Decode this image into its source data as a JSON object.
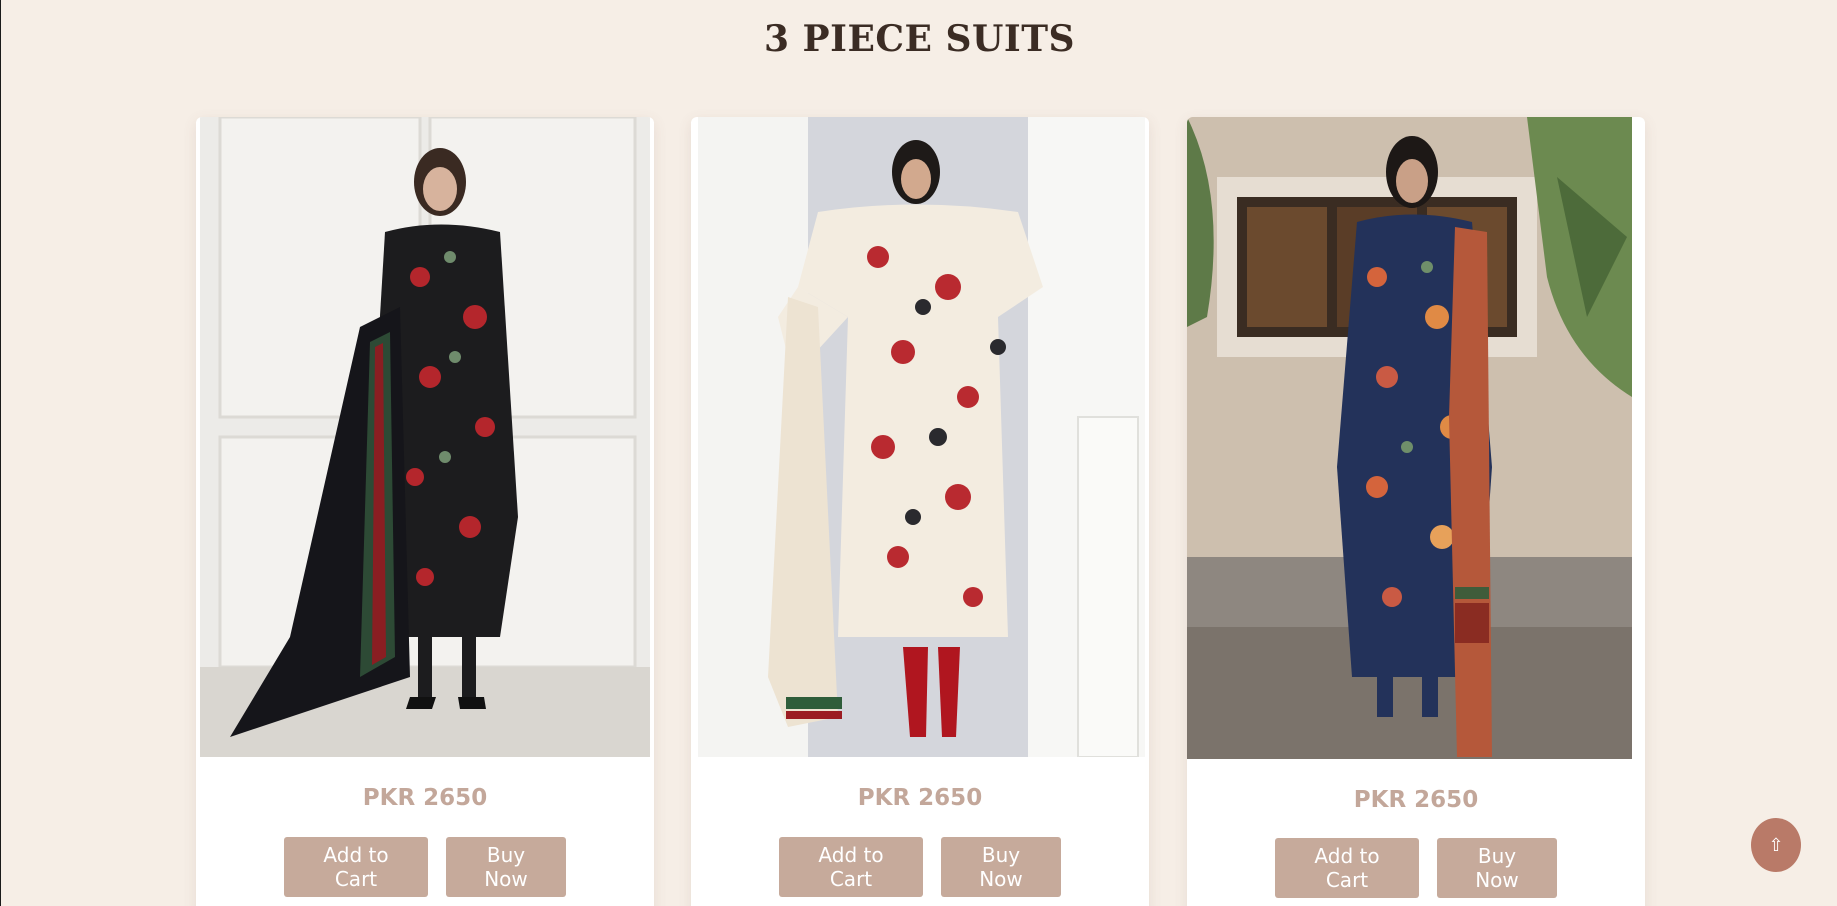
{
  "section": {
    "title": "3 PIECE SUITS"
  },
  "products": [
    {
      "price": "PKR 2650",
      "add_to_cart_label": "Add to Cart",
      "buy_now_label": "Buy Now"
    },
    {
      "price": "PKR 2650",
      "add_to_cart_label": "Add to Cart",
      "buy_now_label": "Buy Now"
    },
    {
      "price": "PKR 2650",
      "add_to_cart_label": "Add to Cart",
      "buy_now_label": "Buy Now"
    }
  ],
  "scroll_top": {
    "icon": "arrow-up-icon",
    "glyph": "⇧"
  },
  "colors": {
    "background": "#f6eee6",
    "title": "#3b2c24",
    "price": "#c3a79a",
    "button": "#c6aa9b",
    "scroll_button": "#b97a68"
  }
}
